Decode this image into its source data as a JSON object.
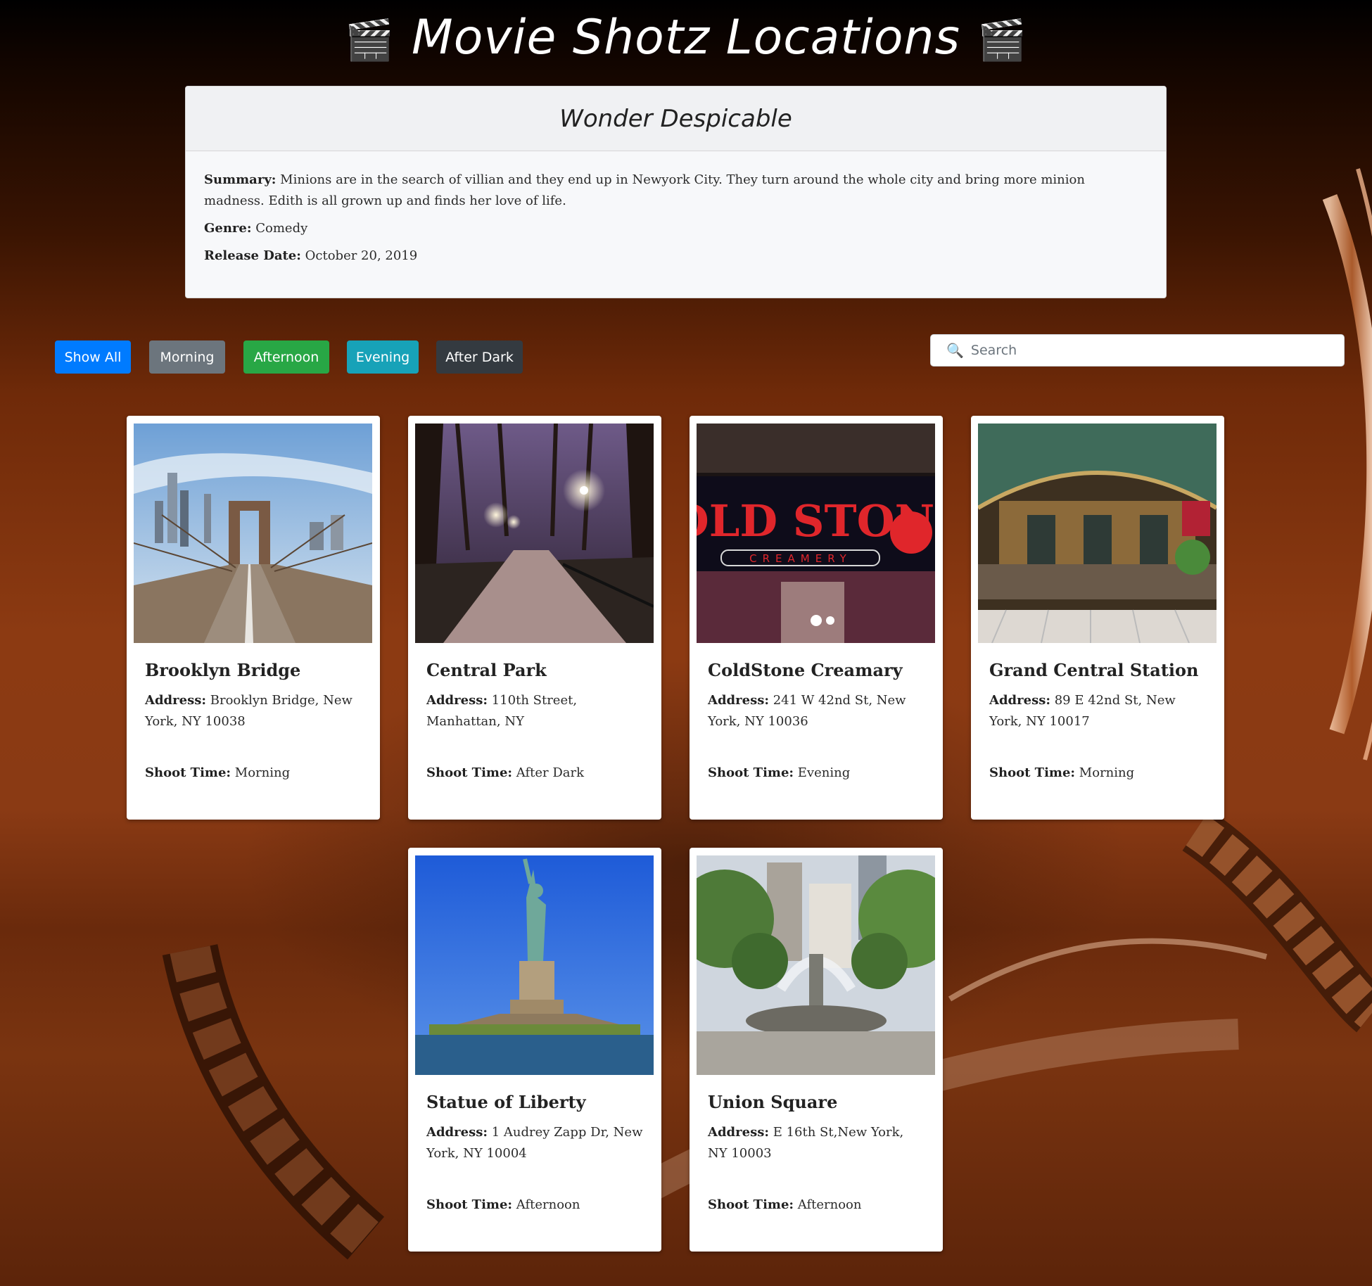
{
  "header": {
    "title": "Movie Shotz Locations",
    "clap_icon": "🎬"
  },
  "movie": {
    "title": "Wonder Despicable",
    "summary_label": "Summary:",
    "summary": "Minions are in the search of villian and they end up in Newyork City. They turn around the whole city and bring more minion madness. Edith is all grown up and finds her love of life.",
    "genre_label": "Genre:",
    "genre": "Comedy",
    "release_label": "Release Date:",
    "release": "October 20, 2019"
  },
  "filters": {
    "show_all": "Show All",
    "morning": "Morning",
    "afternoon": "Afternoon",
    "evening": "Evening",
    "after_dark": "After Dark"
  },
  "colors": {
    "show_all": "#007bff",
    "morning": "#6c757d",
    "afternoon": "#28a745",
    "evening": "#17a2b8",
    "after_dark": "#343a40"
  },
  "search": {
    "placeholder": "Search",
    "icon": "🔍"
  },
  "labels": {
    "address": "Address:",
    "shoot_time": "Shoot Time:"
  },
  "locations": [
    {
      "name": "Brooklyn Bridge",
      "address": "Brooklyn Bridge, New York, NY 10038",
      "shoot_time": "Morning"
    },
    {
      "name": "Central Park",
      "address": "110th Street, Manhattan, NY",
      "shoot_time": "After Dark"
    },
    {
      "name": "ColdStone Creamary",
      "address": "241 W 42nd St, New York, NY 10036",
      "shoot_time": "Evening",
      "sign_main": "COLD STONE",
      "sign_sub": "CREAMERY"
    },
    {
      "name": "Grand Central Station",
      "address": "89 E 42nd St, New York, NY 10017",
      "shoot_time": "Morning"
    },
    {
      "name": "Statue of Liberty",
      "address": "1 Audrey Zapp Dr, New York, NY 10004",
      "shoot_time": "Afternoon"
    },
    {
      "name": "Union Square",
      "address": "E 16th St,New York, NY 10003",
      "shoot_time": "Afternoon"
    }
  ]
}
